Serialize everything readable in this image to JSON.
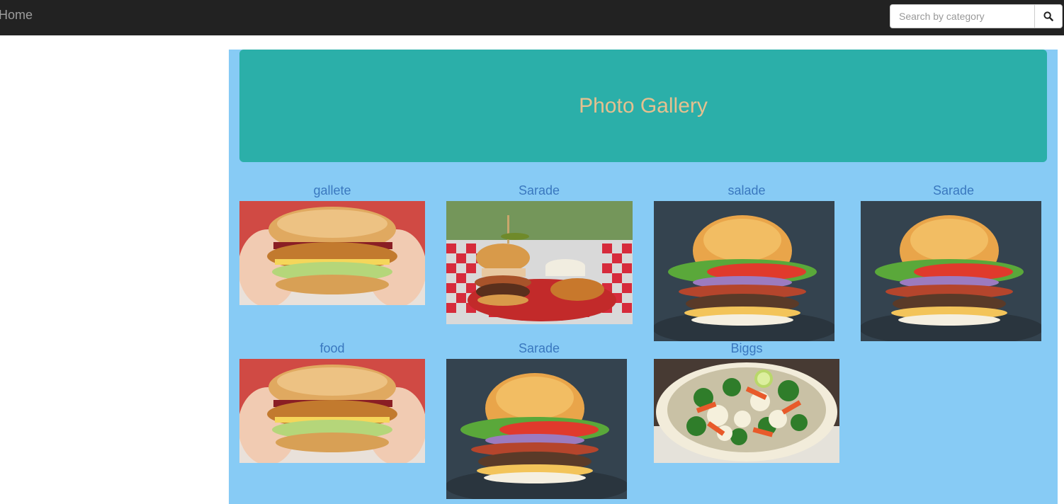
{
  "navbar": {
    "home_label": "Home",
    "search_placeholder": "Search by category",
    "search_icon": "search-icon"
  },
  "jumbotron": {
    "title": "Photo Gallery"
  },
  "gallery": {
    "items": [
      {
        "label": "gallete",
        "image": "chicken-burger-in-hands"
      },
      {
        "label": "Sarade",
        "image": "burger-basket-checkered"
      },
      {
        "label": "salade",
        "image": "loaded-burger-dark-background"
      },
      {
        "label": "Sarade",
        "image": "loaded-burger-dark-background"
      },
      {
        "label": "food",
        "image": "chicken-burger-in-hands"
      },
      {
        "label": "Sarade",
        "image": "loaded-burger-dark-background"
      },
      {
        "label": "Biggs",
        "image": "vegetable-salad-bowl"
      }
    ]
  },
  "colors": {
    "navbar_bg": "#222222",
    "main_bg": "#87cbf5",
    "jumbotron_bg": "#2bafa9",
    "jumbotron_text": "#e6c08f",
    "label_text": "#3a78bf"
  }
}
